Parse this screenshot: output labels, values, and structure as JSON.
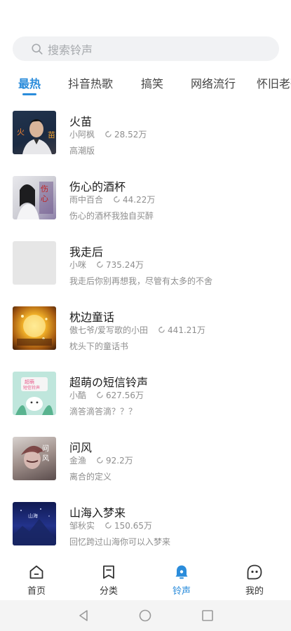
{
  "search": {
    "placeholder": "搜索铃声"
  },
  "tabs": [
    {
      "label": "最热",
      "active": true
    },
    {
      "label": "抖音热歌",
      "active": false
    },
    {
      "label": "搞笑",
      "active": false
    },
    {
      "label": "网络流行",
      "active": false
    },
    {
      "label": "怀旧老歌",
      "active": false
    }
  ],
  "ringtones": [
    {
      "title": "火苗",
      "artist": "小阿枫",
      "plays": "28.52万",
      "desc": "高潮版",
      "cover_text": "火 苗"
    },
    {
      "title": "伤心的酒杯",
      "artist": "雨中百合",
      "plays": "44.22万",
      "desc": "伤心的酒杯我独自买醉",
      "cover_text": "伤心"
    },
    {
      "title": "我走后",
      "artist": "小咪",
      "plays": "735.24万",
      "desc": "我走后你别再想我，尽管有太多的不舍",
      "cover_text": ""
    },
    {
      "title": "枕边童话",
      "artist": "傲七爷/爱写歌的小田",
      "plays": "441.21万",
      "desc": "枕头下的童话书",
      "cover_text": ""
    },
    {
      "title": "超萌の短信铃声",
      "artist": "小酷",
      "plays": "627.56万",
      "desc": "滴答滴答滴？？？",
      "cover_text": "超萌 短信铃声"
    },
    {
      "title": "问风",
      "artist": "金渔",
      "plays": "92.2万",
      "desc": "离合的定义",
      "cover_text": "问 风"
    },
    {
      "title": "山海入梦来",
      "artist": "邹秋实",
      "plays": "150.65万",
      "desc": "回忆跨过山海你可以入梦来",
      "cover_text": "山海"
    }
  ],
  "nav": [
    {
      "label": "首页",
      "icon": "home-icon",
      "active": false
    },
    {
      "label": "分类",
      "icon": "bookmark-icon",
      "active": false
    },
    {
      "label": "铃声",
      "icon": "bell-icon",
      "active": true
    },
    {
      "label": "我的",
      "icon": "profile-face-icon",
      "active": false
    }
  ],
  "colors": {
    "accent": "#2a8cdb",
    "search_bg": "#f1f2f4",
    "muted_text": "#8e8e8e"
  }
}
